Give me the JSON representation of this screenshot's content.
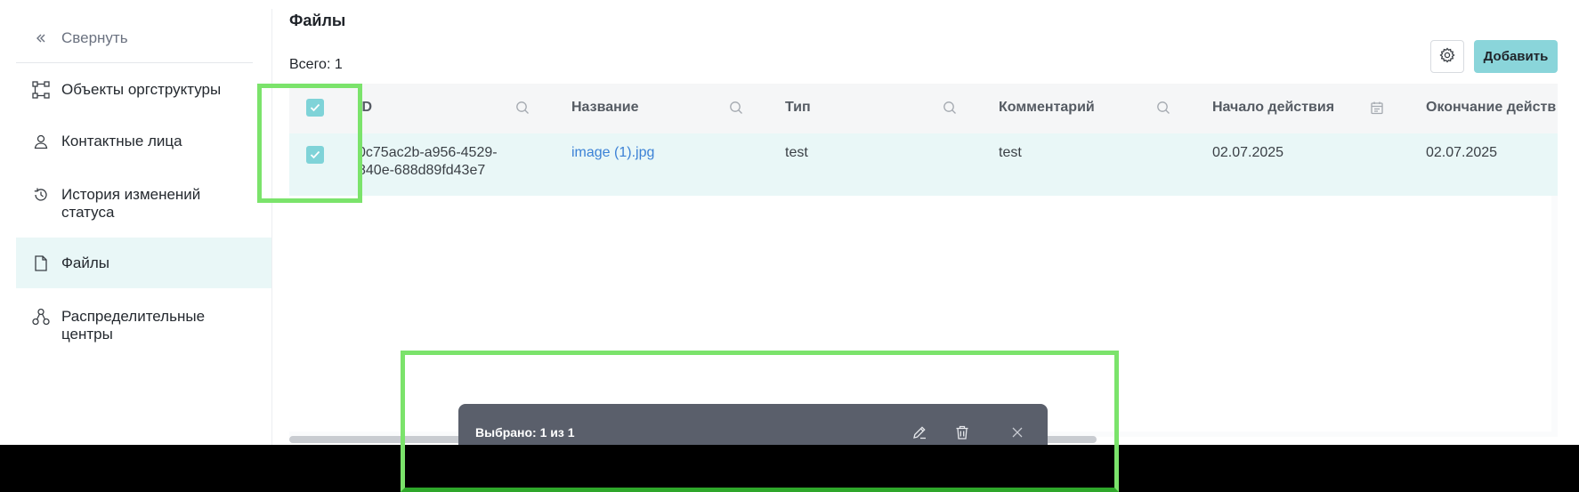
{
  "sidebar": {
    "collapse_label": "Свернуть",
    "items": [
      {
        "label": "Объекты оргструктуры",
        "icon": "org-structure-icon"
      },
      {
        "label": "Контактные лица",
        "icon": "person-icon"
      },
      {
        "label": "История изменений статуса",
        "icon": "history-icon"
      },
      {
        "label": "Файлы",
        "icon": "file-icon",
        "active": true
      },
      {
        "label": "Распределительные центры",
        "icon": "network-icon"
      }
    ]
  },
  "page": {
    "title": "Файлы",
    "total": "Всего: 1",
    "add_label": "Добавить"
  },
  "table": {
    "columns": [
      "ID",
      "Название",
      "Тип",
      "Комментарий",
      "Начало действия",
      "Окончание действ"
    ],
    "rows": [
      {
        "id_line1": "0c75ac2b-a956-4529-",
        "id_line2": "840e-688d89fd43e7",
        "name": "image (1).jpg",
        "type": "test",
        "comment": "test",
        "start": "02.07.2025",
        "end": "02.07.2025",
        "checked": true
      }
    ],
    "header_checked": true
  },
  "selection_bar": {
    "text": "Выбрано: 1 из 1"
  },
  "colors": {
    "accent": "#8ad5da",
    "row_selected": "#e9f7f7",
    "link": "#3c82d6",
    "selection_bar": "#5a5f6b",
    "highlight": "#7be36b"
  }
}
